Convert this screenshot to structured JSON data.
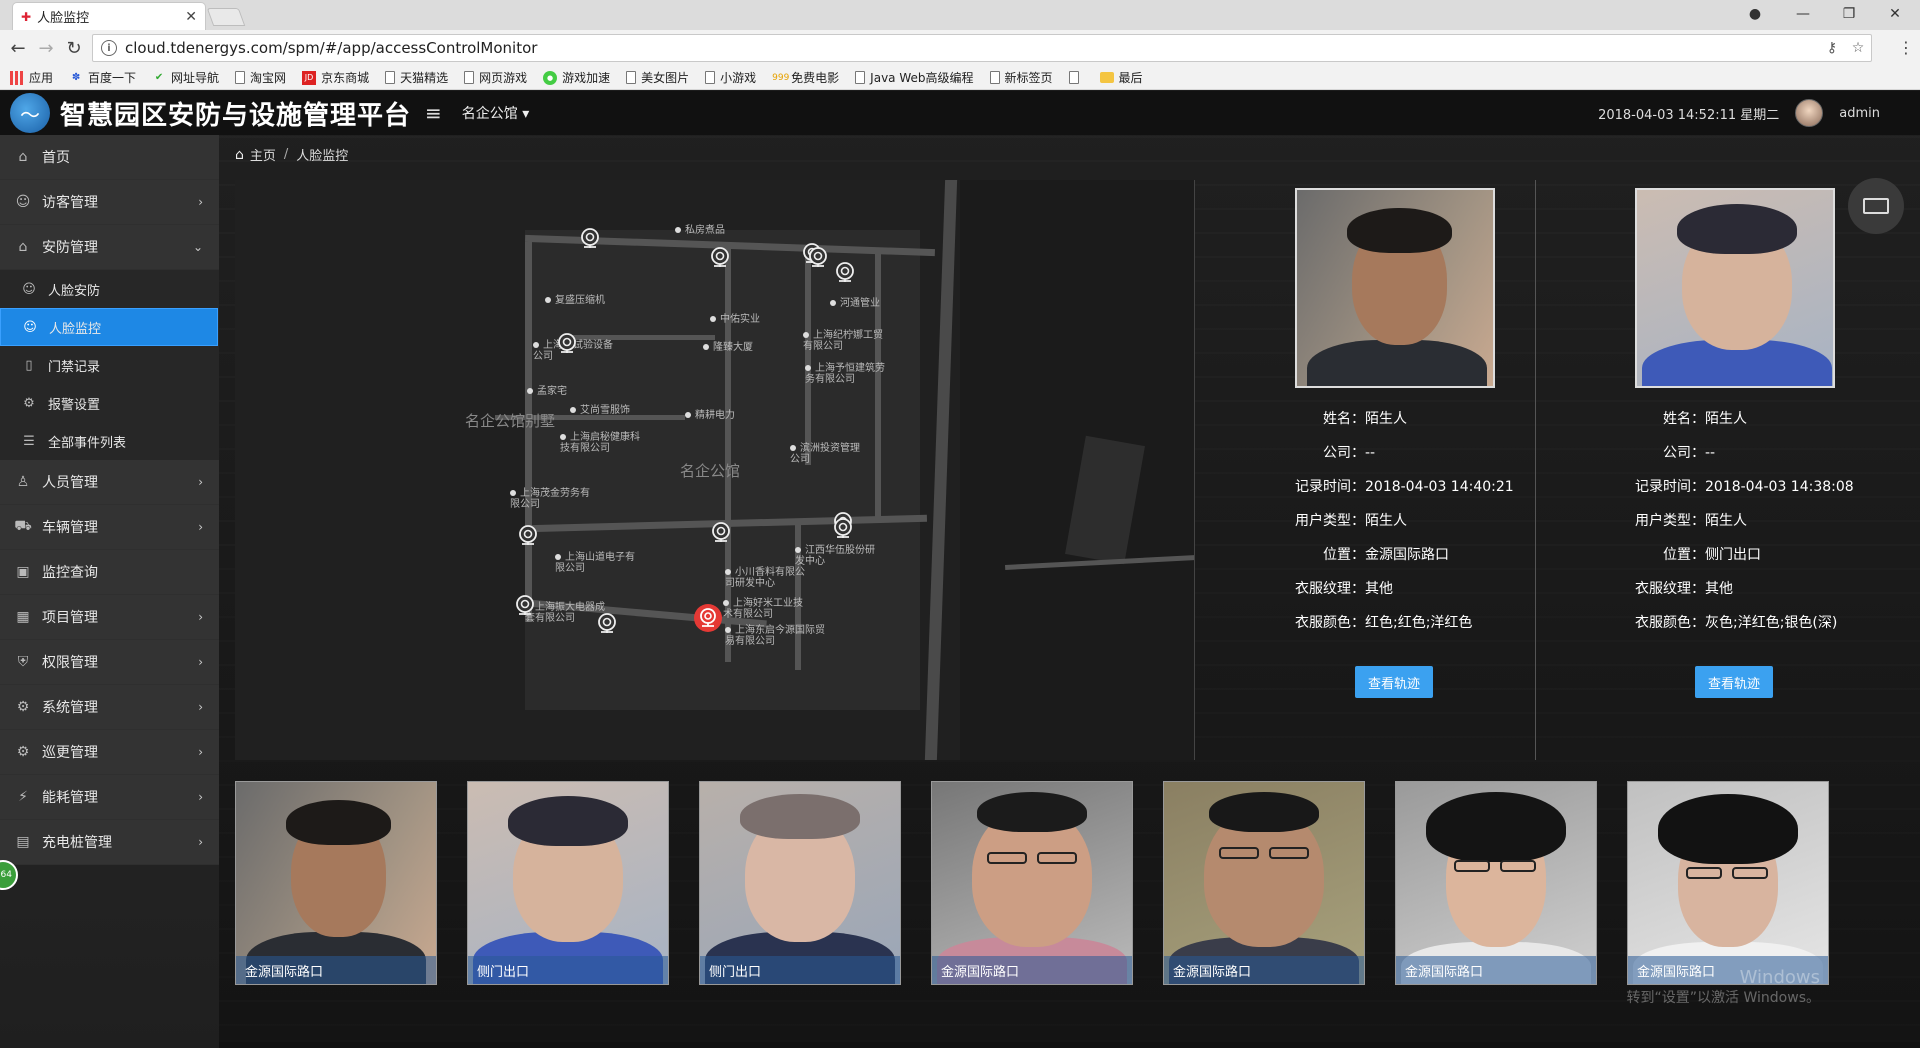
{
  "browser": {
    "tab_title": "人脸监控",
    "url": "cloud.tdenergys.com/spm/#/app/accessControlMonitor",
    "bookmarks": [
      "应用",
      "百度一下",
      "网址导航",
      "淘宝网",
      "京东商城",
      "天猫精选",
      "网页游戏",
      "游戏加速",
      "美女图片",
      "小游戏",
      "免费电影",
      "Java Web高级编程",
      "新标签页",
      "最后"
    ]
  },
  "header": {
    "app_title": "智慧园区安防与设施管理平台",
    "site": "名企公馆",
    "datetime": "2018-04-03 14:52:11 星期二",
    "user": "admin"
  },
  "sidebar": {
    "items": [
      {
        "label": "首页",
        "icon": "home-icon"
      },
      {
        "label": "访客管理",
        "icon": "visitor-icon"
      },
      {
        "label": "安防管理",
        "icon": "security-icon"
      },
      {
        "label": "人员管理",
        "icon": "person-icon"
      },
      {
        "label": "车辆管理",
        "icon": "car-icon"
      },
      {
        "label": "监控查询",
        "icon": "monitor-icon"
      },
      {
        "label": "项目管理",
        "icon": "grid-icon"
      },
      {
        "label": "权限管理",
        "icon": "shield-icon"
      },
      {
        "label": "系统管理",
        "icon": "gear-icon"
      },
      {
        "label": "巡更管理",
        "icon": "patrol-icon"
      },
      {
        "label": "能耗管理",
        "icon": "energy-icon"
      },
      {
        "label": "充电桩管理",
        "icon": "charger-icon"
      }
    ],
    "sub_items": [
      {
        "label": "人脸安防"
      },
      {
        "label": "人脸监控"
      },
      {
        "label": "门禁记录"
      },
      {
        "label": "报警设置"
      },
      {
        "label": "全部事件列表"
      }
    ]
  },
  "breadcrumb": {
    "home": "主页",
    "current": "人脸监控"
  },
  "map": {
    "areas": [
      "名企公馆别墅",
      "名企公馆"
    ],
    "pois": [
      "私房煮品",
      "复盛压缩机",
      "中佑实业",
      "河通管业",
      "上海纪柠娜工贸有限公司",
      "上海测试验设备公司",
      "隆臻大厦",
      "上海予恒建筑劳务有限公司",
      "孟家宅",
      "艾尚雪服饰",
      "精耕电力",
      "上海启秘健康科技有限公司",
      "滨洲投资管理公司",
      "上海茂金劳务有限公司",
      "上海山道电子有限公司",
      "江西华伍股份研发中心",
      "小川香料有限公司研发中心",
      "上海振大电器成套有限公司",
      "上海好米工业技术有限公司",
      "上海东启今源国际贸易有限公司"
    ]
  },
  "labels": {
    "name": "姓名：",
    "company": "公司：",
    "record_time": "记录时间：",
    "user_type": "用户类型：",
    "location": "位置：",
    "texture": "衣服纹理：",
    "color": "衣服颜色：",
    "track_button": "查看轨迹"
  },
  "records": [
    {
      "name": "陌生人",
      "company": "--",
      "record_time": "2018-04-03 14:40:21",
      "user_type": "陌生人",
      "location": "金源国际路口",
      "texture": "其他",
      "color": "红色;红色;洋红色"
    },
    {
      "name": "陌生人",
      "company": "--",
      "record_time": "2018-04-03 14:38:08",
      "user_type": "陌生人",
      "location": "侧门出口",
      "texture": "其他",
      "color": "灰色;洋红色;银色(深)"
    }
  ],
  "thumbnails": [
    {
      "caption": "金源国际路口"
    },
    {
      "caption": "侧门出口"
    },
    {
      "caption": "侧门出口"
    },
    {
      "caption": "金源国际路口"
    },
    {
      "caption": "金源国际路口"
    },
    {
      "caption": "金源国际路口"
    },
    {
      "caption": "金源国际路口"
    }
  ],
  "watermark": {
    "line1": "Windows",
    "line2": "转到“设置”以激活 Windows。"
  },
  "badge": "64",
  "colors": {
    "accent": "#1e88e5",
    "button": "#3ba1f0",
    "header_bg": "#111111",
    "sidebar_bg": "#2a2a2a",
    "alert_camera": "#e53935"
  }
}
